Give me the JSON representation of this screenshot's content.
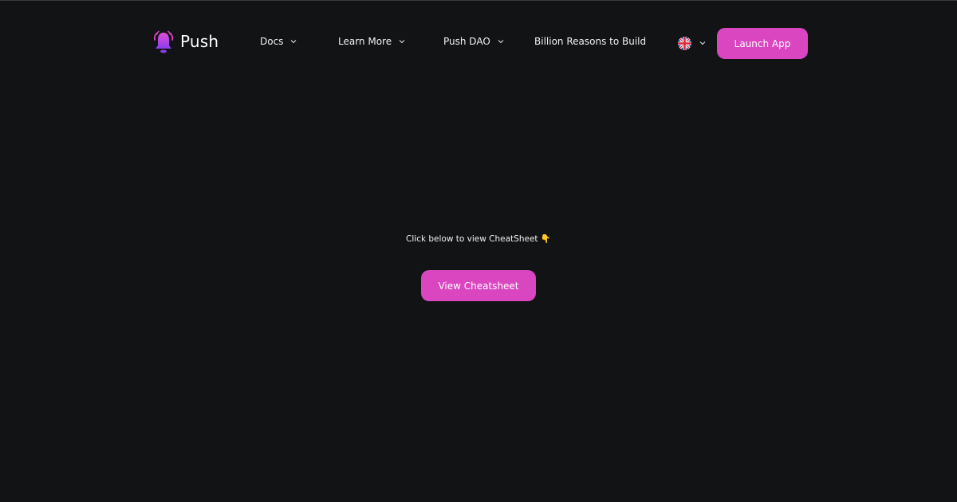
{
  "header": {
    "logo_text": "Push",
    "nav": [
      {
        "label": "Docs",
        "has_dropdown": true
      },
      {
        "label": "Learn More",
        "has_dropdown": true
      },
      {
        "label": "Push DAO",
        "has_dropdown": true
      },
      {
        "label": "Billion Reasons to Build",
        "has_dropdown": false
      }
    ],
    "language_icon": "uk-flag-icon",
    "launch_label": "Launch App"
  },
  "main": {
    "prompt": "Click below to view CheatSheet 👇",
    "button_label": "View Cheatsheet"
  },
  "colors": {
    "background": "#121315",
    "accent": "#d946c0"
  }
}
